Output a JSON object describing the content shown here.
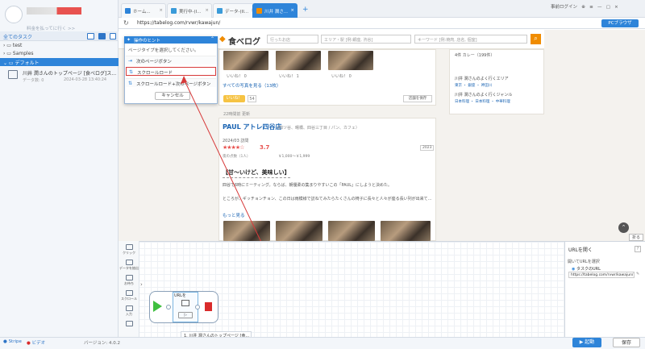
{
  "app": {
    "upgrade": "料金を払ってに行く >>",
    "all_tasks": "全てのタスク",
    "tree": {
      "test": "test",
      "samples": "Samples",
      "default": "デフォルト"
    },
    "task": {
      "title": "川井 潤さんのトップページ [食べログ]ス...",
      "meta": "データ数: 0",
      "date": "2024-03-28 13:40:24"
    }
  },
  "browser": {
    "tabs": [
      {
        "label": "ホーム..."
      },
      {
        "label": "実行中-(I..."
      },
      {
        "label": "データ-(II..."
      },
      {
        "label": "川井 潤さ..."
      }
    ],
    "plus": "+",
    "url": "https://tabelog.com/rvwr/kawajun/",
    "top_right": "事前ログイン",
    "pc_browser": "PCブラウザ"
  },
  "tabelog": {
    "logo": "食べログ",
    "search_placeholder_area": "行ったお店",
    "search_placeholder_area2": "エリア・駅 [例:銀座, 渋谷]",
    "search_placeholder_kw": "キーワード [例:焼肉, 店名, 個室]",
    "photo_likes": [
      "いいね！ 0",
      "いいね！ 1",
      "いいね！ 0"
    ],
    "all_photos": "すべての写真を見る（13枚）",
    "iine_btn": "いいね！",
    "iine_count": "54",
    "save_store": "店舗を保存",
    "ago": "22時間前 更新",
    "shop_name": "PAUL アトレ四谷店",
    "shop_sub": "（四ツ谷、曙橋、四谷三丁目 / パン、カフェ）",
    "visit": "2024/03 訪問",
    "stars": "★★★★☆",
    "rating": "3.7",
    "year_badge": "2023",
    "people": "夜の点数（1人）",
    "price": "￥1,000～￥1,999",
    "review_title": "【甘～いけど、美味しい】",
    "review_p1": "四谷で6時にミーティング。ならば、朝優柔の集まりやすいこの「PAUL」にしようと決めた。",
    "review_p2": "ところが、ギッチョンチョン、この日は雨模様で訪ねてみたらたくさんの椅子に長々と人々が座る長い列が出来て...",
    "more": "もっと見る",
    "side_curry": "4件 カレー（199件）",
    "side_area_title": "川井 潤さんのよく行くエリア",
    "side_area_links": "東京 ・ 銀座 ・ 神田川",
    "side_genre_title": "川井 潤さんのよく行くジャンル",
    "side_genre_links": "日本料理 ・ 日本料理 ・ 中華料理",
    "scroll_top": "⌃",
    "fold": "折る"
  },
  "hint": {
    "title": "操作のヒント",
    "desc": "ページタイプを選択してください。",
    "options": [
      {
        "label": "次のページボタン"
      },
      {
        "label": "スクロールロード"
      },
      {
        "label": "スクロールロード+次のページボタン"
      }
    ],
    "cancel": "キャンセル"
  },
  "workflow": {
    "tools": [
      {
        "label": "クリック"
      },
      {
        "label": "データを抽出"
      },
      {
        "label": "お待ち"
      },
      {
        "label": "スクロール"
      },
      {
        "label": "入力"
      }
    ],
    "node_label": "URLを",
    "play": "▷",
    "tab": "1. 川井 潤さんのトップページ [食..."
  },
  "settings": {
    "title": "URLを開く",
    "help": "?",
    "label": "開いてURLを選択",
    "radio": "タスクのURL",
    "url": "https://tabelog.com/rvwr/kawajun/"
  },
  "footer": {
    "stripe": "Stripe",
    "video": "ビデオ",
    "version": "バージョン: 4.0.2",
    "run": "▶ 起動",
    "save": "保存"
  }
}
